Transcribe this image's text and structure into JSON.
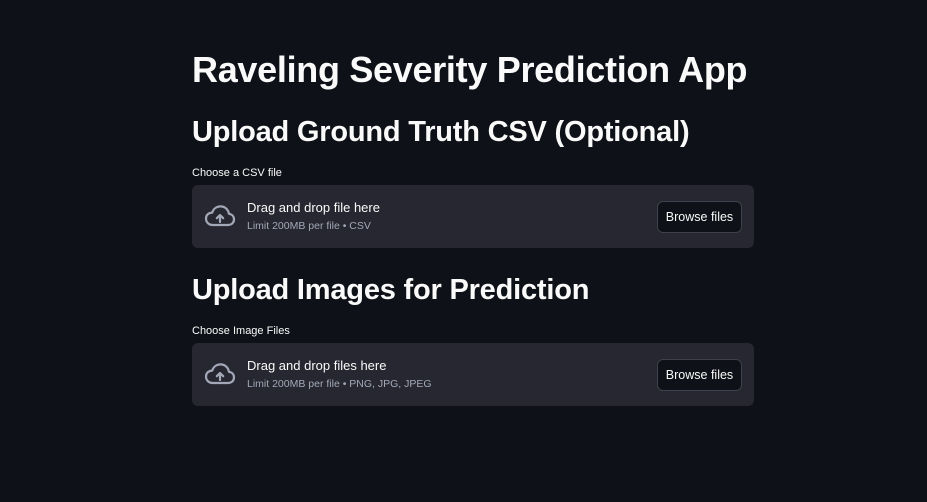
{
  "app": {
    "title": "Raveling Severity Prediction App"
  },
  "csv_section": {
    "heading": "Upload Ground Truth CSV (Optional)",
    "label": "Choose a CSV file",
    "dropzone_text": "Drag and drop file here",
    "dropzone_limit": "Limit 200MB per file • CSV",
    "button_label": "Browse files",
    "icon": "cloud-upload-icon"
  },
  "images_section": {
    "heading": "Upload Images for Prediction",
    "label": "Choose Image Files",
    "dropzone_text": "Drag and drop files here",
    "dropzone_limit": "Limit 200MB per file • PNG, JPG, JPEG",
    "button_label": "Browse files",
    "icon": "cloud-upload-icon"
  },
  "colors": {
    "background": "#0e1117",
    "dropzone": "#262730",
    "text": "#fafafa",
    "muted_text": "#a3a8b8",
    "button_border": "#3e414b"
  }
}
